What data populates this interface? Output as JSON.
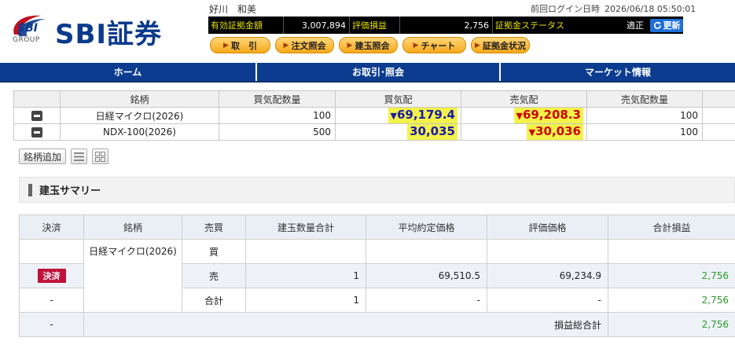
{
  "logo": {
    "badge_text": "SBI",
    "group_text": "GROUP",
    "main_text": "SBI証券"
  },
  "header": {
    "username": "好川　和美",
    "last_login_label": "前回ログイン日時",
    "last_login_value": "2026/06/18 05:50:01"
  },
  "status": {
    "margin_label": "有効証拠金額",
    "margin_value": "3,007,894",
    "pl_label": "評価損益",
    "pl_value": "2,756",
    "status_label": "証拠金ステータス",
    "status_value": "適正",
    "refresh_label": "更新",
    "colors": {
      "label": "#e8e000",
      "refresh": "#1f6fd8"
    }
  },
  "action_buttons": [
    {
      "label": "取　引"
    },
    {
      "label": "注文照会"
    },
    {
      "label": "建玉照会"
    },
    {
      "label": "チャート"
    },
    {
      "label": "証拠金状況"
    }
  ],
  "nav": [
    {
      "label": "ホーム"
    },
    {
      "label": "お取引･照会"
    },
    {
      "label": "マーケット情報"
    }
  ],
  "quote_table": {
    "headers": [
      "",
      "銘柄",
      "買気配数量",
      "買気配",
      "売気配",
      "売気配数量",
      ""
    ],
    "rows": [
      {
        "name": "日経マイクロ(2026)",
        "bid_qty": "100",
        "bid_arrow": "▼",
        "bid": "69,179.4",
        "ask_arrow": "▼",
        "ask": "69,208.3",
        "ask_qty": "100"
      },
      {
        "name": "NDX-100(2026)",
        "bid_qty": "500",
        "bid_arrow": "",
        "bid": "30,035",
        "ask_arrow": "▼",
        "ask": "30,036",
        "ask_qty": "100"
      }
    ]
  },
  "tools": {
    "add_label": "銘柄追加",
    "icons": [
      "list-view-icon",
      "grid-view-icon"
    ]
  },
  "summary": {
    "title": "建玉サマリー"
  },
  "positions": {
    "headers": [
      "決済",
      "銘柄",
      "売買",
      "建玉数量合計",
      "平均約定価格",
      "評価価格",
      "合計損益"
    ],
    "instrument": "日経マイクロ(2026)",
    "rows": [
      {
        "settle": "",
        "side": "買",
        "qty": "",
        "avg": "",
        "eval": "",
        "pl": ""
      },
      {
        "settle": "決済",
        "side": "売",
        "qty": "1",
        "avg": "69,510.5",
        "eval": "69,234.9",
        "pl": "2,756"
      },
      {
        "settle": "-",
        "side": "合計",
        "qty": "1",
        "avg": "-",
        "eval": "-",
        "pl": "2,756"
      }
    ],
    "total": {
      "settle": "-",
      "label": "損益総合計",
      "value": "2,756"
    },
    "colors": {
      "settle_button": "#c0113a",
      "profit": "#2a9a2a"
    }
  }
}
